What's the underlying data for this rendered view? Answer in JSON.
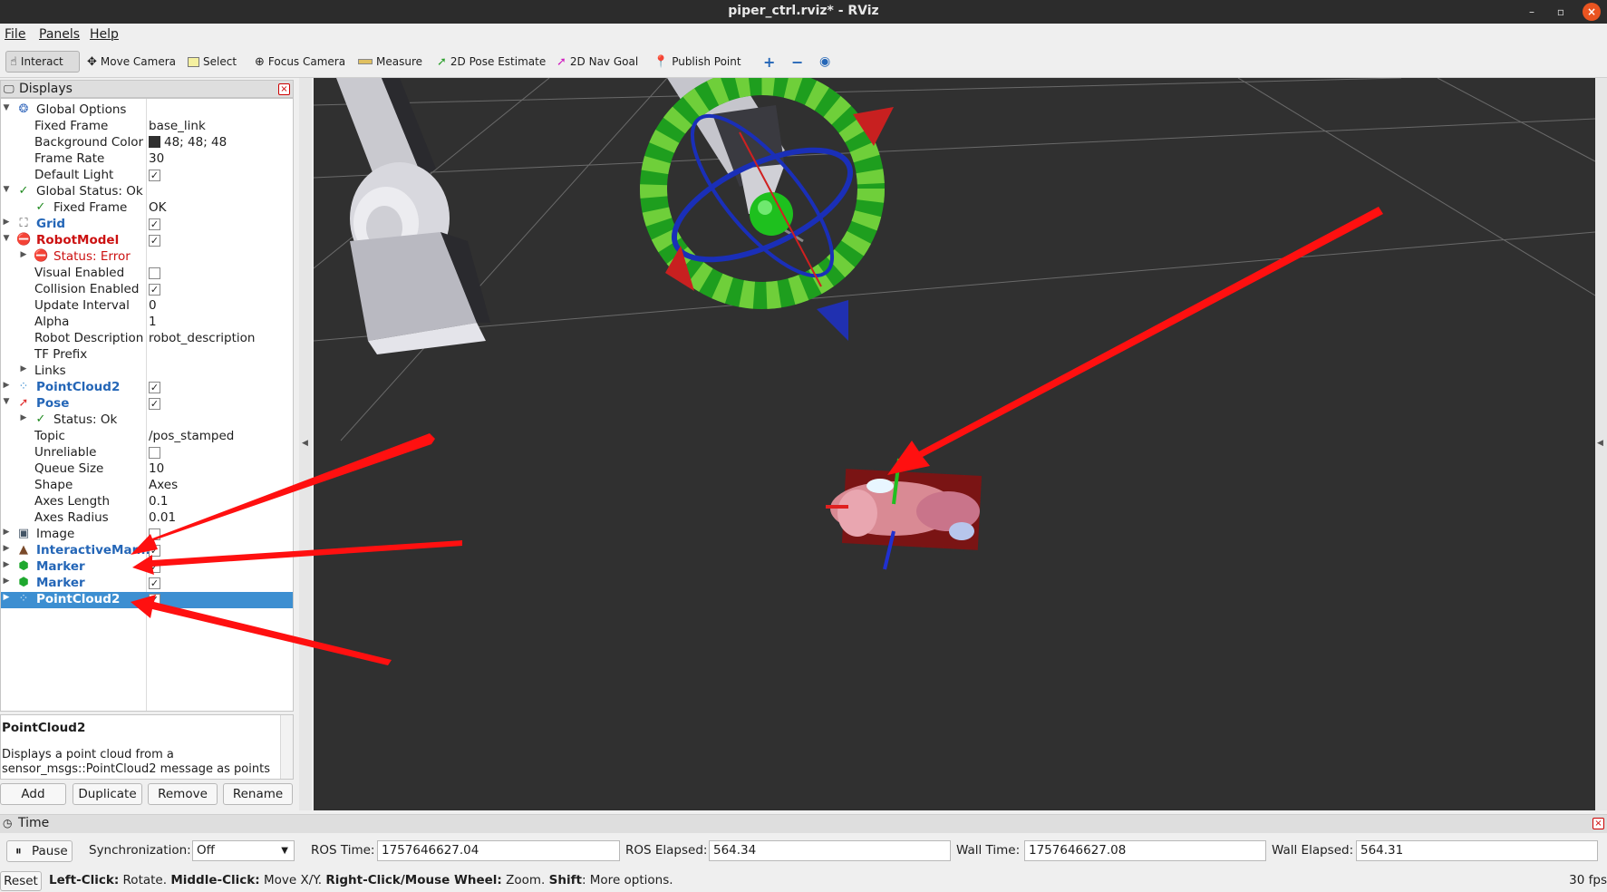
{
  "window": {
    "title": "piper_ctrl.rviz* - RViz"
  },
  "menu": [
    "File",
    "Panels",
    "Help"
  ],
  "toolbar": {
    "interact": "Interact",
    "move_camera": "Move Camera",
    "select": "Select",
    "focus_camera": "Focus Camera",
    "measure": "Measure",
    "pose_estimate": "2D Pose Estimate",
    "nav_goal": "2D Nav Goal",
    "publish_point": "Publish Point"
  },
  "displays": {
    "title": "Displays",
    "rows": [
      {
        "name": "Global Options"
      },
      {
        "name": "Fixed Frame",
        "value": "base_link"
      },
      {
        "name": "Background Color",
        "value": "48; 48; 48",
        "color": "#303030"
      },
      {
        "name": "Frame Rate",
        "value": "30"
      },
      {
        "name": "Default Light",
        "checked": true
      },
      {
        "name": "Global Status: Ok"
      },
      {
        "name": "Fixed Frame",
        "value": "OK"
      },
      {
        "name": "Grid",
        "checked": true
      },
      {
        "name": "RobotModel",
        "checked": true
      },
      {
        "name": "Status: Error"
      },
      {
        "name": "Visual Enabled",
        "checked": false
      },
      {
        "name": "Collision Enabled",
        "checked": true
      },
      {
        "name": "Update Interval",
        "value": "0"
      },
      {
        "name": "Alpha",
        "value": "1"
      },
      {
        "name": "Robot Description",
        "value": "robot_description"
      },
      {
        "name": "TF Prefix",
        "value": ""
      },
      {
        "name": "Links"
      },
      {
        "name": "PointCloud2",
        "checked": true
      },
      {
        "name": "Pose",
        "checked": true
      },
      {
        "name": "Status: Ok"
      },
      {
        "name": "Topic",
        "value": "/pos_stamped"
      },
      {
        "name": "Unreliable",
        "checked": false
      },
      {
        "name": "Queue Size",
        "value": "10"
      },
      {
        "name": "Shape",
        "value": "Axes"
      },
      {
        "name": "Axes Length",
        "value": "0.1"
      },
      {
        "name": "Axes Radius",
        "value": "0.01"
      },
      {
        "name": "Image",
        "checked": false
      },
      {
        "name": "InteractiveMar...",
        "checked": true
      },
      {
        "name": "Marker",
        "checked": true
      },
      {
        "name": "Marker",
        "checked": true
      },
      {
        "name": "PointCloud2",
        "checked": true
      }
    ],
    "description_title": "PointCloud2",
    "description_text": "Displays a point cloud from a sensor_msgs::PointCloud2 message as points",
    "buttons": {
      "add": "Add",
      "duplicate": "Duplicate",
      "remove": "Remove",
      "rename": "Rename"
    }
  },
  "time": {
    "title": "Time",
    "pause": "Pause",
    "sync_label": "Synchronization:",
    "sync_value": "Off",
    "ros_time_label": "ROS Time:",
    "ros_time": "1757646627.04",
    "ros_elapsed_label": "ROS Elapsed:",
    "ros_elapsed": "564.34",
    "wall_time_label": "Wall Time:",
    "wall_time": "1757646627.08",
    "wall_elapsed_label": "Wall Elapsed:",
    "wall_elapsed": "564.31"
  },
  "status": {
    "reset": "Reset",
    "left_click": "Left-Click:",
    "left_click_action": "Rotate.",
    "middle_click": "Middle-Click:",
    "middle_click_action": "Move X/Y.",
    "right_click": "Right-Click/Mouse Wheel:",
    "right_click_action": "Zoom.",
    "shift": "Shift",
    "shift_action": ": More options.",
    "fps": "30 fps"
  },
  "colors": {
    "viewport_bg": "#303030",
    "selection": "#3d8fd1",
    "annotation_arrow": "#ff1010"
  }
}
